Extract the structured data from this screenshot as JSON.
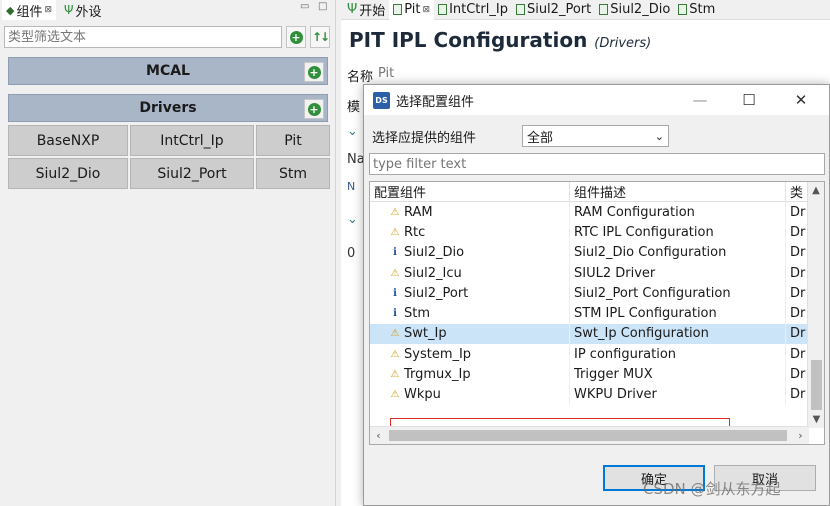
{
  "left_panel": {
    "tab_components": "组件",
    "tab_peripherals": "外设",
    "filter_placeholder": "类型筛选文本",
    "groups": [
      {
        "name": "MCAL"
      },
      {
        "name": "Drivers",
        "items": [
          "BaseNXP",
          "IntCtrl_Ip",
          "Pit",
          "Siul2_Dio",
          "Siul2_Port",
          "Stm"
        ]
      }
    ]
  },
  "editor": {
    "tabs": [
      "开始",
      "Pit",
      "IntCtrl_Ip",
      "Siul2_Port",
      "Siul2_Dio",
      "Stm"
    ],
    "title": "PIT IPL Configuration",
    "subtitle": "(Drivers)",
    "name_label": "名称",
    "name_value": "Pit",
    "module_label_fragment": "模",
    "na_fragment": "Na",
    "n_fragment": "N",
    "zero_fragment": "0"
  },
  "dialog": {
    "title": "选择配置组件",
    "provide_label": "选择应提供的组件",
    "provide_value": "全部",
    "filter_placeholder": "type filter text",
    "columns": [
      "配置组件",
      "组件描述",
      "类"
    ],
    "rows": [
      {
        "icon": "warning",
        "name": "RAM",
        "desc": "RAM Configuration",
        "type": "Dr"
      },
      {
        "icon": "warning",
        "name": "Rtc",
        "desc": "RTC IPL Configuration",
        "type": "Dr"
      },
      {
        "icon": "info",
        "name": "Siul2_Dio",
        "desc": "Siul2_Dio Configuration",
        "type": "Dr"
      },
      {
        "icon": "warning",
        "name": "Siul2_Icu",
        "desc": "SIUL2 Driver",
        "type": "Dr"
      },
      {
        "icon": "info",
        "name": "Siul2_Port",
        "desc": "Siul2_Port Configuration",
        "type": "Dr"
      },
      {
        "icon": "info",
        "name": "Stm",
        "desc": "STM IPL Configuration",
        "type": "Dr"
      },
      {
        "icon": "warning",
        "name": "Swt_Ip",
        "desc": "Swt_Ip Configuration",
        "type": "Dr",
        "selected": true
      },
      {
        "icon": "warning",
        "name": "System_Ip",
        "desc": "IP configuration",
        "type": "Dr"
      },
      {
        "icon": "warning",
        "name": "Trgmux_Ip",
        "desc": "Trigger MUX",
        "type": "Dr"
      },
      {
        "icon": "warning",
        "name": "Wkpu",
        "desc": "WKPU Driver",
        "type": "Dr"
      }
    ],
    "ok_label": "确定",
    "cancel_label": "取消"
  },
  "watermark": "CSDN @剑从东方起",
  "colors": {
    "group_header": "#a9b6c8",
    "selected_row": "#cce4f7",
    "highlight_box": "#e0302b",
    "add_icon": "#2f8f3a"
  }
}
